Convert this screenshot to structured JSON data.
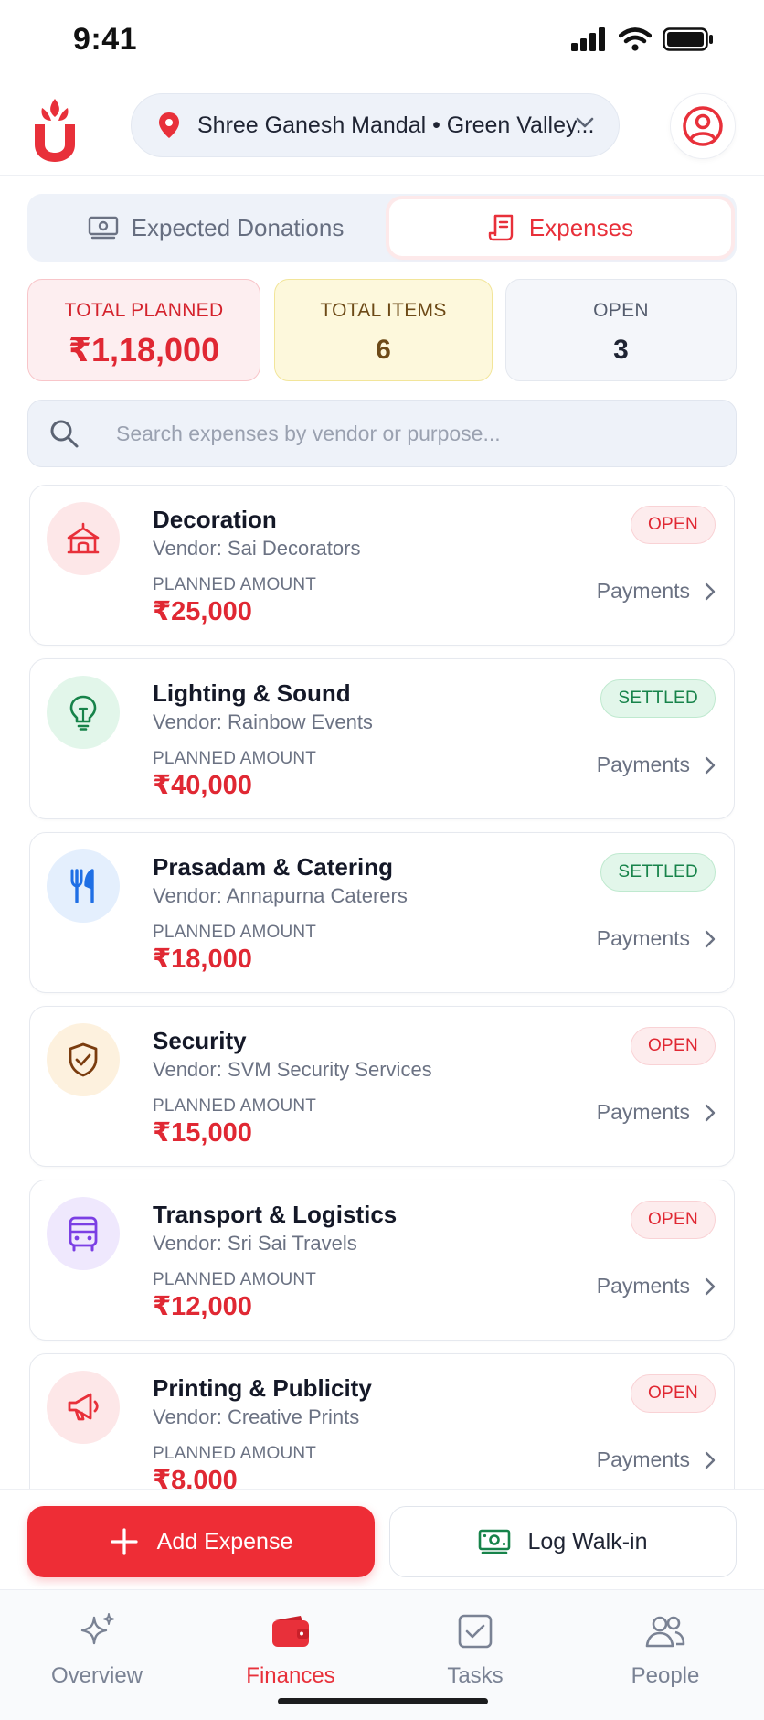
{
  "status_bar": {
    "time": "9:41"
  },
  "header": {
    "location": "Shree Ganesh Mandal  •  Green Valley...",
    "icons": {
      "logo": "app-logo",
      "pin": "location-pin-icon",
      "chevron": "chevron-down-icon",
      "profile": "user-circle-icon"
    }
  },
  "tabs": [
    {
      "label": "Expected Donations",
      "icon": "money-icon",
      "active": false
    },
    {
      "label": "Expenses",
      "icon": "receipt-icon",
      "active": true
    }
  ],
  "stats": {
    "total_planned": {
      "label": "TOTAL PLANNED",
      "value": "₹1,18,000"
    },
    "total_items": {
      "label": "TOTAL ITEMS",
      "value": "6"
    },
    "open": {
      "label": "OPEN",
      "value": "3"
    }
  },
  "search": {
    "placeholder": "Search expenses by vendor or purpose..."
  },
  "planned_amount_label": "PLANNED AMOUNT",
  "expenses": [
    {
      "title": "Decoration",
      "vendor": "Vendor: Sai Decorators",
      "amount": "₹25,000",
      "status": "OPEN",
      "payments": "Payments",
      "icon": "tent-icon"
    },
    {
      "title": "Lighting & Sound",
      "vendor": "Vendor: Rainbow Events",
      "amount": "₹40,000",
      "status": "SETTLED",
      "payments": "Payments",
      "icon": "bulb-icon"
    },
    {
      "title": "Prasadam & Catering",
      "vendor": "Vendor: Annapurna Caterers",
      "amount": "₹18,000",
      "status": "SETTLED",
      "payments": "Payments",
      "icon": "cutlery-icon"
    },
    {
      "title": "Security",
      "vendor": "Vendor: SVM Security Services",
      "amount": "₹15,000",
      "status": "OPEN",
      "payments": "Payments",
      "icon": "shield-check-icon"
    },
    {
      "title": "Transport & Logistics",
      "vendor": "Vendor: Sri Sai Travels",
      "amount": "₹12,000",
      "status": "OPEN",
      "payments": "Payments",
      "icon": "bus-icon"
    },
    {
      "title": "Printing & Publicity",
      "vendor": "Vendor: Creative Prints",
      "amount": "₹8,000",
      "status": "OPEN",
      "payments": "Payments",
      "icon": "megaphone-icon"
    }
  ],
  "actions": {
    "add_expense": "Add Expense",
    "log_walkin": "Log Walk-in"
  },
  "nav": [
    {
      "label": "Overview",
      "icon": "sparkles-icon",
      "active": false
    },
    {
      "label": "Finances",
      "icon": "wallet-icon",
      "active": true
    },
    {
      "label": "Tasks",
      "icon": "checkbox-icon",
      "active": false
    },
    {
      "label": "People",
      "icon": "people-icon",
      "active": false
    }
  ],
  "colors": {
    "accent": "#e8303a",
    "open_badge": "#e02833",
    "settled_badge": "#17834a",
    "avatars": [
      "#fde7e8",
      "#e2f6ea",
      "#e4effd",
      "#fdf1de",
      "#efe8fd",
      "#fde7e8"
    ]
  }
}
